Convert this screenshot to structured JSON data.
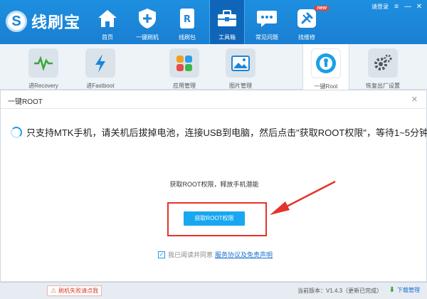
{
  "app": {
    "logo_glyph": "S",
    "name": "线刷宝"
  },
  "top_right": {
    "login": "请登录",
    "menu": "≡",
    "minimize": "—",
    "close": "✕"
  },
  "nav": {
    "items": [
      {
        "label": "首页",
        "icon": "home-icon"
      },
      {
        "label": "一键刷机",
        "icon": "shield-plus-icon"
      },
      {
        "label": "线刷包",
        "icon": "package-icon"
      },
      {
        "label": "工具箱",
        "icon": "toolbox-icon",
        "active": true
      },
      {
        "label": "常见问题",
        "icon": "chat-icon"
      },
      {
        "label": "找维修",
        "icon": "repair-icon",
        "badge": "new"
      }
    ]
  },
  "toolbar": {
    "tools": [
      {
        "label": "进Recovery",
        "icon": "recovery-icon"
      },
      {
        "label": "进Fastboot",
        "icon": "fastboot-icon"
      },
      {
        "label": "应用管理",
        "icon": "app-grid-icon"
      },
      {
        "label": "图片管理",
        "icon": "image-icon"
      },
      {
        "label": "一键Root",
        "icon": "root-icon",
        "active": true
      },
      {
        "label": "恢复出厂设置",
        "icon": "gear-icon"
      }
    ]
  },
  "dialog": {
    "title": "一键ROOT",
    "close": "✕",
    "notice": "只支持MTK手机，请关机后拔掉电池，连接USB到电脑，然后点击\"获取ROOT权限\"，等待1~5分钟",
    "subtitle": "获取ROOT权限，释放手机潜能",
    "button": "获取ROOT权限",
    "agree_checked": true,
    "agree_text": "我已阅读并同意",
    "agree_link": "服务协议及免责声明"
  },
  "status": {
    "help": "刷机失败请点我",
    "version": "当前版本：V1.4.3（更新已完成）",
    "download": "下载管理"
  },
  "colors": {
    "header": "#1a86d8",
    "accent": "#18a7f0",
    "highlight": "#e5322a"
  }
}
